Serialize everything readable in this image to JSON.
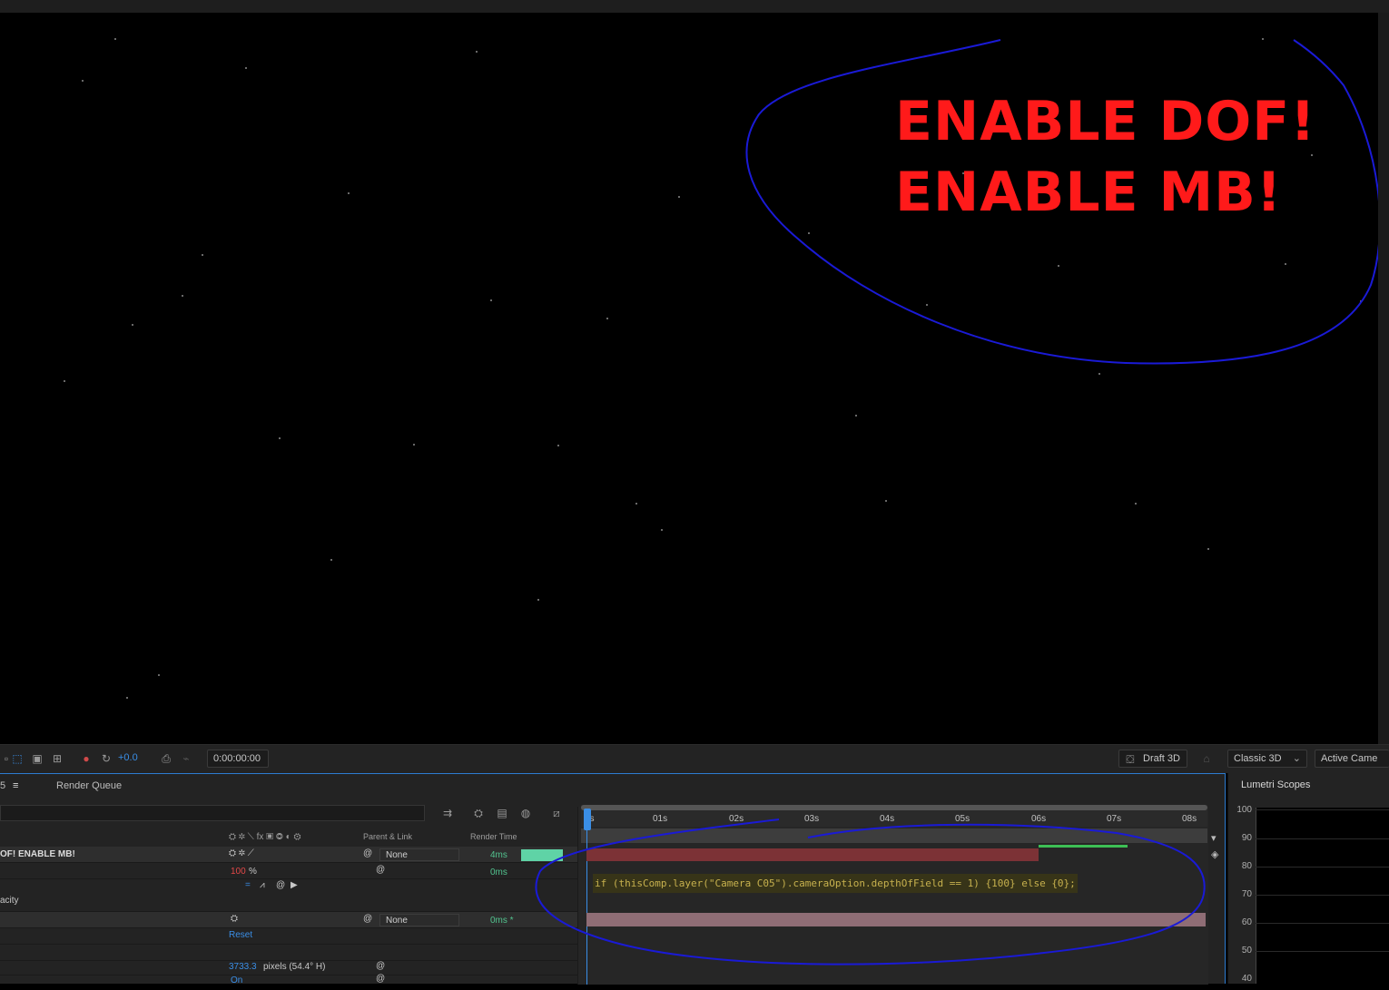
{
  "viewer": {
    "annotation_line1": "ENABLE DOF!",
    "annotation_line2": "ENABLE MB!"
  },
  "viewer_toolbar": {
    "exposure": "+0.0",
    "timecode": "0:00:00:00",
    "renderer": "Draft 3D",
    "renderer_mode": "Classic 3D",
    "view": "Active Came"
  },
  "timeline": {
    "tab_partial": "5",
    "tab_render_queue": "Render Queue",
    "col_parent": "Parent & Link",
    "col_render_time": "Render Time",
    "ruler": [
      "0s",
      "01s",
      "02s",
      "03s",
      "04s",
      "05s",
      "06s",
      "07s",
      "08s"
    ],
    "rows": {
      "layer_name": "OF! ENABLE MB!",
      "layer_parent": "None",
      "layer_render_time": "4ms",
      "opacity_value": "100",
      "opacity_unit": "%",
      "opacity_render_time": "0ms",
      "opacity_label": "acity",
      "camera_parent": "None",
      "camera_render_time": "0ms *",
      "reset_label": "Reset",
      "zoom_value": "3733.3",
      "zoom_unit": "pixels (54.4° H)",
      "on_label": "On"
    },
    "expression": "if (thisComp.layer(\"Camera C05\").cameraOption.depthOfField == 1) {100} else {0};"
  },
  "lumetri": {
    "title": "Lumetri Scopes",
    "scale": [
      "100",
      "90",
      "80",
      "70",
      "60",
      "50",
      "40"
    ]
  }
}
